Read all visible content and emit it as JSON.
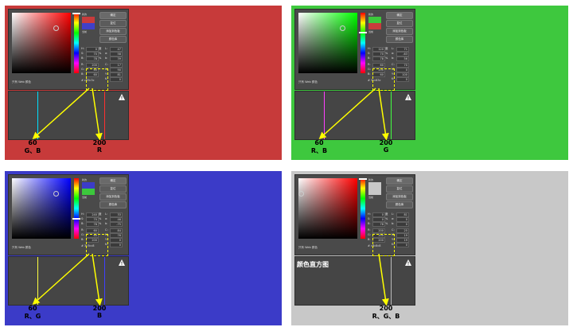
{
  "ui": {
    "swatch_new": "新的",
    "swatch_current": "当前",
    "btn_ok": "确定",
    "btn_reset": "复位",
    "btn_add_swatch": "添加到色板",
    "btn_libraries": "颜色库",
    "only_web": "只有 Web 颜色",
    "hist_title": "颜色直方图",
    "pct": "%",
    "deg": "度"
  },
  "panels": [
    {
      "id": "red",
      "bg": "#c73a3a",
      "r": "200",
      "g": "60",
      "b": "60",
      "hex": "c83c3c",
      "h": "0",
      "s": "70",
      "br": "78",
      "L": "47",
      "a": "58",
      "bb": "39",
      "c": "17",
      "m": "90",
      "y": "81",
      "k": "0",
      "num1": "60",
      "lbl1": "G、B",
      "num2": "200",
      "lbl2": "R"
    },
    {
      "id": "green",
      "bg": "#3ec83e",
      "r": "60",
      "g": "200",
      "b": "60",
      "hex": "3cc83c",
      "h": "120",
      "s": "70",
      "br": "78",
      "L": "71",
      "a": "-63",
      "bb": "56",
      "c": "70",
      "m": "0",
      "y": "100",
      "k": "0",
      "num1": "60",
      "lbl1": "R、B",
      "num2": "200",
      "lbl2": "G"
    },
    {
      "id": "blue",
      "bg": "#3b3bc8",
      "r": "60",
      "g": "60",
      "b": "200",
      "hex": "3c3cc8",
      "h": "240",
      "s": "70",
      "br": "78",
      "L": "33",
      "a": "46",
      "bb": "-75",
      "c": "84",
      "m": "76",
      "y": "0",
      "k": "0",
      "num1": "60",
      "lbl1": "R、G",
      "num2": "200",
      "lbl2": "B"
    },
    {
      "id": "gray",
      "bg": "#c8c8c8",
      "r": "200",
      "g": "200",
      "b": "200",
      "hex": "c8c8c8",
      "h": "0",
      "s": "0",
      "br": "78",
      "L": "81",
      "a": "0",
      "bb": "0",
      "c": "25",
      "m": "19",
      "y": "19",
      "k": "0",
      "num2": "200",
      "lbl2": "R、G、B"
    }
  ]
}
